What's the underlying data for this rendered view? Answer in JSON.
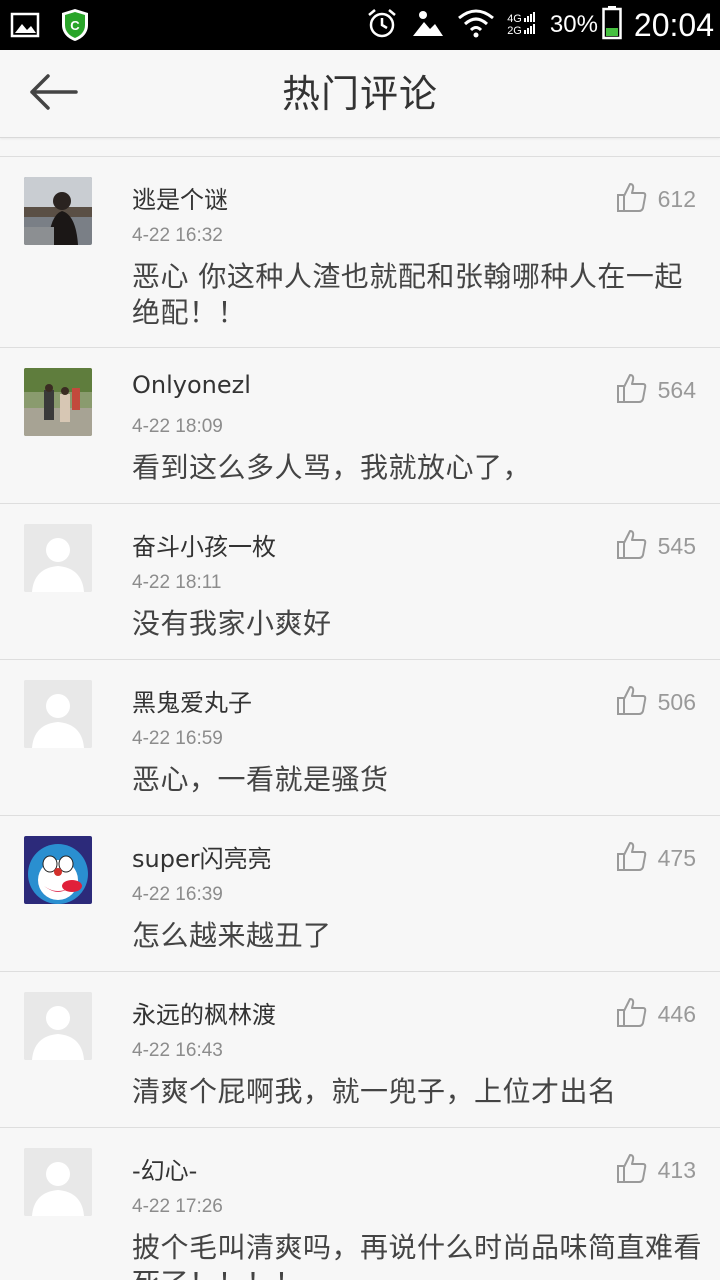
{
  "status_bar": {
    "network_top": "4G",
    "network_bottom": "2G",
    "battery_pct": "30%",
    "time": "20:04"
  },
  "header": {
    "title": "热门评论",
    "back_icon": "back-arrow-icon"
  },
  "comments": [
    {
      "user": "逃是个谜",
      "time": "4-22 16:32",
      "text": "恶心 你这种人渣也就配和张翰哪种人在一起 绝配！！",
      "likes": "612",
      "avatar": "photo-avatar"
    },
    {
      "user": "Onlyonezl",
      "time": "4-22 18:09",
      "text": "看到这么多人骂，我就放心了，",
      "likes": "564",
      "avatar": "photo-avatar"
    },
    {
      "user": "奋斗小孩一枚",
      "time": "4-22 18:11",
      "text": "没有我家小爽好",
      "likes": "545",
      "avatar": "default-avatar"
    },
    {
      "user": "黑鬼爱丸子",
      "time": "4-22 16:59",
      "text": "恶心，一看就是骚货",
      "likes": "506",
      "avatar": "default-avatar"
    },
    {
      "user": "super闪亮亮",
      "time": "4-22 16:39",
      "text": "怎么越来越丑了",
      "likes": "475",
      "avatar": "cartoon-avatar"
    },
    {
      "user": "永远的枫林渡",
      "time": "4-22 16:43",
      "text": "清爽个屁啊我，就一兜子，上位才出名",
      "likes": "446",
      "avatar": "default-avatar"
    },
    {
      "user": "-幻心-",
      "time": "4-22 17:26",
      "text": "披个毛叫清爽吗，再说什么时尚品味简直难看死了！！！！",
      "likes": "413",
      "avatar": "default-avatar"
    }
  ]
}
